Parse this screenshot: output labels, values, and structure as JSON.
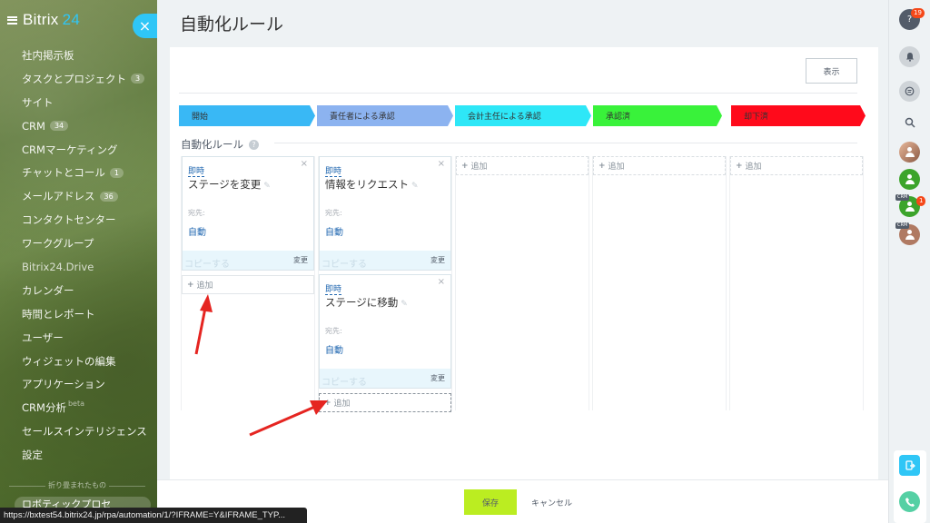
{
  "sidebar": {
    "logo_name": "Bitrix",
    "logo_num": "24",
    "items": [
      {
        "label": "社内掲示板",
        "badge": ""
      },
      {
        "label": "タスクとプロジェクト",
        "badge": "3"
      },
      {
        "label": "サイト",
        "badge": ""
      },
      {
        "label": "CRM",
        "badge": "34"
      },
      {
        "label": "CRMマーケティング",
        "badge": ""
      },
      {
        "label": "チャットとコール",
        "badge": "1"
      },
      {
        "label": "メールアドレス",
        "badge": "36"
      },
      {
        "label": "コンタクトセンター",
        "badge": ""
      },
      {
        "label": "ワークグループ",
        "badge": ""
      },
      {
        "label": "Bitrix24.Drive",
        "badge": ""
      },
      {
        "label": "カレンダー",
        "badge": ""
      },
      {
        "label": "時間とレポート",
        "badge": ""
      },
      {
        "label": "ユーザー",
        "badge": ""
      },
      {
        "label": "ウィジェットの編集",
        "badge": ""
      },
      {
        "label": "アプリケーション",
        "badge": ""
      },
      {
        "label": "CRM分析",
        "badge": "",
        "sup": "beta"
      },
      {
        "label": "セールスインテリジェンス",
        "badge": ""
      },
      {
        "label": "設定",
        "badge": ""
      }
    ],
    "folded_label": "折り畳まれたもの",
    "bottom_item": "ロボティックプロセ",
    "close": "×"
  },
  "status_url": "https://bxtest54.bitrix24.jp/rpa/automation/1/?IFRAME=Y&IFRAME_TYP...",
  "page": {
    "title": "自動化ルール",
    "view_button": "表示",
    "section_title": "自動化ルール",
    "help": "?"
  },
  "stages": [
    {
      "label": "開始",
      "color": "#39b8f5"
    },
    {
      "label": "責任者による承認",
      "color": "#8cb3f0"
    },
    {
      "label": "会計主任による承認",
      "color": "#2ee7f7"
    },
    {
      "label": "承認済",
      "color": "#39f23a"
    },
    {
      "label": "却下済",
      "color": "#ff0a1b"
    }
  ],
  "rules": [
    {
      "timing": "即時",
      "name": "ステージを変更",
      "to_label": "宛先:",
      "to_value": "自動",
      "copy": "コピーする",
      "change": "変更"
    },
    {
      "timing": "即時",
      "name": "情報をリクエスト",
      "to_label": "宛先:",
      "to_value": "自動",
      "copy": "コピーする",
      "change": "変更"
    },
    {
      "timing": "即時",
      "name": "ステージに移動",
      "to_label": "宛先:",
      "to_value": "自動",
      "copy": "コピーする",
      "change": "変更"
    }
  ],
  "add_label": "追加",
  "footer": {
    "save": "保存",
    "cancel": "キャンセル"
  },
  "rightbar": {
    "help_count": "19",
    "crm_tag": "CRM",
    "crm_count": "1"
  }
}
